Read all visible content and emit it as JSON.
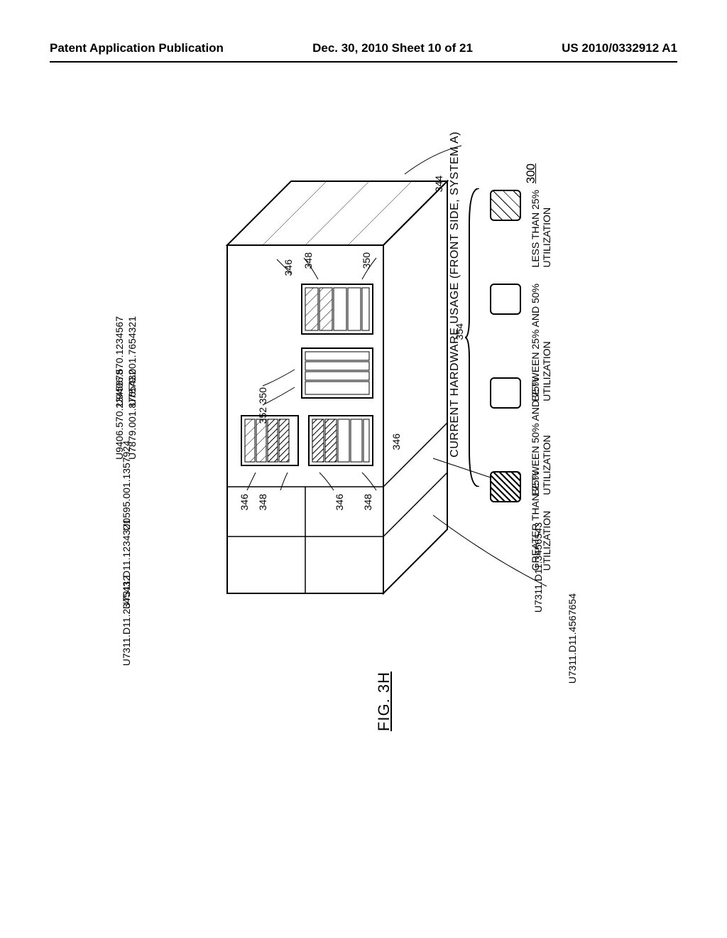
{
  "page_header": {
    "left": "Patent Application Publication",
    "center": "Dec. 30, 2010  Sheet 10 of 21",
    "right": "US 2010/0332912 A1"
  },
  "figure": {
    "title": "CURRENT HARDWARE USAGE (FRONT SIDE, SYSTEM A)",
    "number_label": "300",
    "caption": "FIG. 3H"
  },
  "legend": {
    "group_ref": "354",
    "top_ref": "344",
    "items": [
      {
        "key": "lt25",
        "label": "LESS THAN 25%\nUTILIZATION",
        "pattern": "sw-diag-sparse"
      },
      {
        "key": "25_50",
        "label": "BETWEEN 25% AND 50%\nUTILIZATION",
        "pattern": "sw-plain"
      },
      {
        "key": "50_75",
        "label": "BETWEEN 50% AND 75%\nUTILIZATION",
        "pattern": "sw-plain"
      },
      {
        "key": "gt75",
        "label": "GREATER THAN 75%\nUTILIZATION",
        "pattern": "sw-diag-dense"
      }
    ]
  },
  "row_labels": [
    "U9406.570.1234567",
    "U7879.001.7654321",
    "U9406.570.2345678",
    "U7879.001.8765432",
    "U0595.001.1357924",
    "U7311.D11.1234321",
    "U7311.D11.2345432"
  ],
  "extra_labels": [
    "U7311.D11.3456543",
    "U7311.D11.4567654"
  ],
  "ref_numbers": {
    "r344": "344",
    "r346": "346",
    "r348": "348",
    "r350": "350",
    "r352": "352",
    "r354": "354"
  },
  "chart_data": {
    "type": "table",
    "title": "CURRENT HARDWARE USAGE (FRONT SIDE, SYSTEM A)",
    "reference_numeral": "300",
    "rows": [
      {
        "label": "U9406.570.1234567",
        "pairs_with": "U7879.001.7654321"
      },
      {
        "label": "U7879.001.7654321"
      },
      {
        "label": "U9406.570.2345678",
        "pairs_with": "U7879.001.8765432"
      },
      {
        "label": "U7879.001.8765432"
      },
      {
        "label": "U0595.001.1357924"
      },
      {
        "label": "U7311.D11.1234321"
      },
      {
        "label": "U7311.D11.2345432"
      }
    ],
    "side_rows": [
      {
        "label": "U7311.D11.3456543"
      },
      {
        "label": "U7311.D11.4567654"
      }
    ],
    "legend": [
      {
        "range": "<25%",
        "label": "LESS THAN 25% UTILIZATION"
      },
      {
        "range": "25%-50%",
        "label": "BETWEEN 25% AND 50% UTILIZATION"
      },
      {
        "range": "50%-75%",
        "label": "BETWEEN 50% AND 75% UTILIZATION"
      },
      {
        "range": ">75%",
        "label": "GREATER THAN 75% UTILIZATION"
      }
    ],
    "callout_refs": {
      "344": "top-of-rack leader",
      "346": "card/slot element",
      "348": "card/slot element",
      "350": "component pointer",
      "352": "component pointer",
      "354": "legend brace"
    }
  }
}
